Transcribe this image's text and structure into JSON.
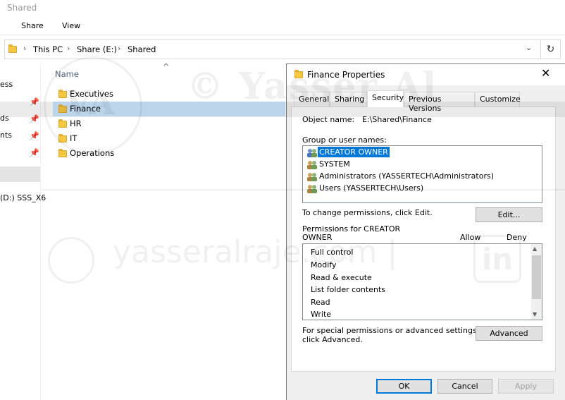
{
  "window": {
    "title": "Shared"
  },
  "ribbon": {
    "tabs": [
      "Share",
      "View"
    ]
  },
  "address": {
    "crumbs": [
      "This PC",
      "Share (E:)",
      "Shared"
    ],
    "dropdown": "⌄",
    "refresh": "↻"
  },
  "nav": {
    "items": [
      "ess",
      "ds",
      "nts",
      "(D:) SSS_X6"
    ]
  },
  "file_list": {
    "column_name": "Name",
    "folders": [
      "Executives",
      "Finance",
      "HR",
      "IT",
      "Operations"
    ],
    "selected": "Finance"
  },
  "watermark": {
    "brand": "© Yasser Al",
    "site": "yasseralraje.com  |",
    "initials": "VA",
    "linkedin": "in"
  },
  "dialog": {
    "title": "Finance Properties",
    "close": "✕",
    "tabs": [
      "General",
      "Sharing",
      "Security",
      "Previous Versions",
      "Customize"
    ],
    "active_tab": "Security",
    "object_name_label": "Object name:",
    "object_name_value": "E:\\Shared\\Finance",
    "group_label": "Group or user names:",
    "users": [
      "CREATOR OWNER",
      "SYSTEM",
      "Administrators (YASSERTECH\\Administrators)",
      "Users (YASSERTECH\\Users)"
    ],
    "change_perm_text": "To change permissions, click Edit.",
    "edit_button": "Edit...",
    "perm_for_line1": "Permissions for CREATOR",
    "perm_for_line2": "OWNER",
    "allow_header": "Allow",
    "deny_header": "Deny",
    "permissions": [
      "Full control",
      "Modify",
      "Read & execute",
      "List folder contents",
      "Read",
      "Write"
    ],
    "special_line1": "For special permissions or advanced settings,",
    "special_line2": "click Advanced.",
    "advanced_button": "Advanced",
    "ok_button": "OK",
    "cancel_button": "Cancel",
    "apply_button": "Apply"
  },
  "colors": {
    "selection_blue": "#0078d7",
    "row_highlight": "#cce8ff",
    "dialog_bg": "#f0f0f0",
    "folder_yellow": "#f5c842"
  }
}
